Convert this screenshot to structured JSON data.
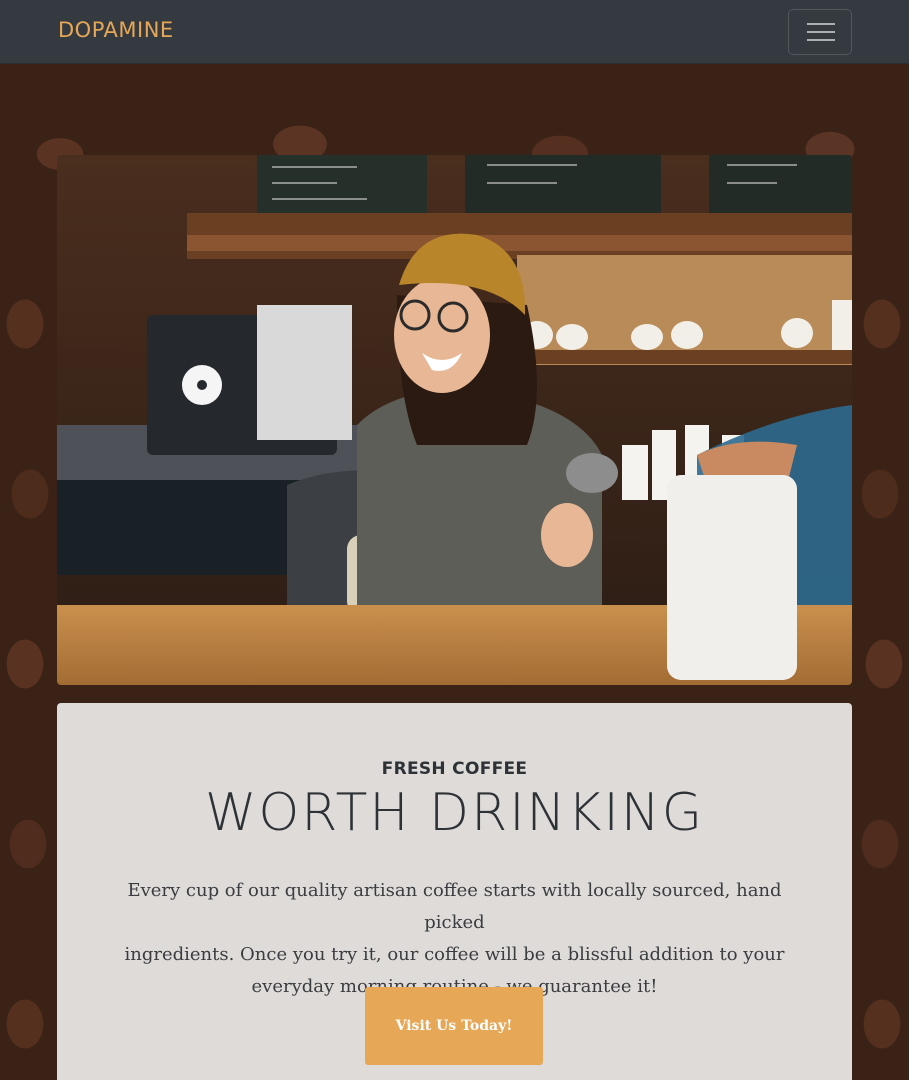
{
  "navbar": {
    "brand": "DOPAMINE",
    "toggler_icon": "hamburger-menu-icon"
  },
  "hero": {
    "image": "barista-smiling-at-coffee-counter-photo"
  },
  "intro": {
    "upper": "FRESH COFFEE",
    "lower": "WORTH DRINKING",
    "text_lines": [
      "Every cup of our quality artisan coffee starts with locally sourced, hand picked",
      "ingredients. Once you try it, our coffee will be a blissful addition to your",
      "everyday morning routine - we guarantee it!"
    ],
    "button_label": "Visit Us Today!"
  },
  "colors": {
    "accent": "#e6a756",
    "navbar_bg": "#343a40",
    "panel_bg": "#ece9e8",
    "text_dark": "#2d3236"
  }
}
